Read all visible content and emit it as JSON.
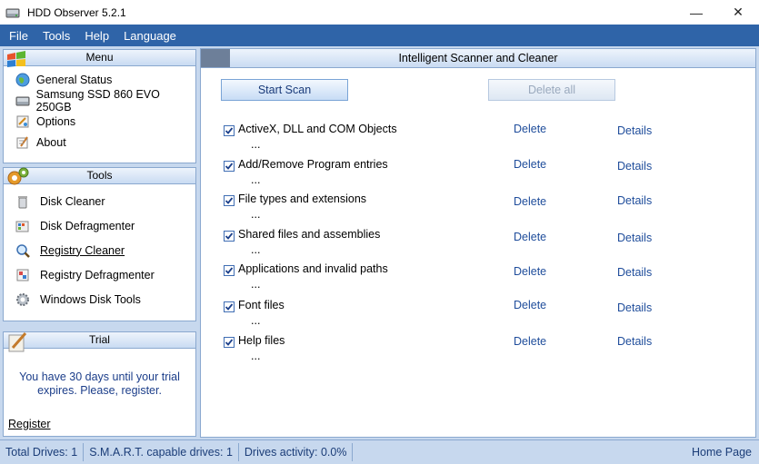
{
  "window": {
    "title": "HDD Observer 5.2.1",
    "controls": {
      "minimize": "—",
      "close": "✕"
    }
  },
  "menubar": [
    "File",
    "Tools",
    "Help",
    "Language"
  ],
  "menu_panel": {
    "title": "Menu",
    "items": [
      {
        "label": "General Status",
        "icon": "globe-icon"
      },
      {
        "label": "Samsung SSD 860 EVO 250GB",
        "icon": "disk-icon"
      },
      {
        "label": "Options",
        "icon": "options-icon"
      },
      {
        "label": "About",
        "icon": "about-icon"
      }
    ]
  },
  "tools_panel": {
    "title": "Tools",
    "items": [
      {
        "label": "Disk Cleaner",
        "icon": "trash-icon"
      },
      {
        "label": "Disk Defragmenter",
        "icon": "defrag-icon"
      },
      {
        "label": "Registry Cleaner",
        "icon": "registry-search-icon",
        "selected": true
      },
      {
        "label": "Registry Defragmenter",
        "icon": "registry-defrag-icon"
      },
      {
        "label": "Windows Disk Tools",
        "icon": "gear-icon"
      }
    ]
  },
  "trial_panel": {
    "title": "Trial",
    "message": "You have 30 days until your trial expires. Please, register.",
    "register_link": "Register"
  },
  "main": {
    "title": "Intelligent Scanner and Cleaner",
    "start_scan": "Start Scan",
    "delete_all": "Delete all",
    "items": [
      {
        "name": "ActiveX, DLL and COM Objects",
        "status": "...",
        "delete": "Delete",
        "details": "Details",
        "checked": true
      },
      {
        "name": "Add/Remove Program entries",
        "status": "...",
        "delete": "Delete",
        "details": "Details",
        "checked": true
      },
      {
        "name": "File types and extensions",
        "status": "...",
        "delete": "Delete",
        "details": "Details",
        "checked": true
      },
      {
        "name": "Shared files and assemblies",
        "status": "...",
        "delete": "Delete",
        "details": "Details",
        "checked": true
      },
      {
        "name": "Applications and invalid paths",
        "status": "...",
        "delete": "Delete",
        "details": "Details",
        "checked": true
      },
      {
        "name": "Font files",
        "status": "...",
        "delete": "Delete",
        "details": "Details",
        "checked": true
      },
      {
        "name": "Help files",
        "status": "...",
        "delete": "Delete",
        "details": "Details",
        "checked": true
      }
    ]
  },
  "statusbar": {
    "total_drives": "Total Drives: 1",
    "smart_drives": "S.M.A.R.T. capable drives: 1",
    "activity": "Drives activity: 0.0%",
    "home": "Home Page"
  },
  "colors": {
    "menubar": "#2f64a8",
    "pane": "#c7d8ee",
    "link": "#1f4d9b",
    "trial_text": "#1c3e8a"
  }
}
